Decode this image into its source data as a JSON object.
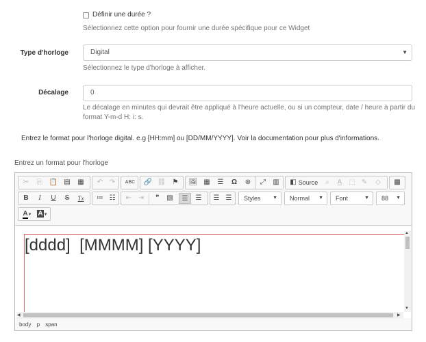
{
  "duration": {
    "checkbox_label": "Définir une durée ?",
    "help": "Sélectionnez cette option pour fournir une durée spécifique pour ce Widget",
    "checked": false
  },
  "clock_type": {
    "label": "Type d'horloge",
    "value": "Digital",
    "help": "Sélectionnez le type d'horloge à afficher."
  },
  "offset": {
    "label": "Décalage",
    "value": "0",
    "help_line1": "Le décalage en minutes qui devrait être appliqué à l'heure actuelle, ou si un compteur, date / heure à partir du",
    "help_line2": "format Y-m-d H: i: s."
  },
  "format_info": "Entrez le format pour l'horloge digital. e.g [HH:mm] ou [DD/MM/YYYY]. Voir la documentation pour plus d'informations.",
  "editor": {
    "label": "Entrez un format pour l'horloge",
    "source_label": "Source",
    "styles_label": "Styles",
    "format_label": "Normal",
    "font_label": "Font",
    "size_label": "88",
    "content": "[dddd]  [MMMM] [YYYY]",
    "path": [
      "body",
      "p",
      "span"
    ],
    "icons": {
      "cut": "✂",
      "copy": "⎘",
      "paste": "📋",
      "paste_text": "▤",
      "paste_word": "▦",
      "undo": "↶",
      "redo": "↷",
      "spellcheck": "ABC",
      "link": "🔗",
      "unlink": "⛓",
      "anchor": "⚑",
      "image": "🖼",
      "table": "▦",
      "hrule": "☰",
      "special_char": "Ω",
      "iframe": "⊛",
      "maximize": "⤢",
      "show_blocks": "▥",
      "source": "◧",
      "find": "⌕",
      "replace": "A̲",
      "select_all": "⬚",
      "remove_format_a": "✎",
      "templates": "◇",
      "qr": "▩",
      "bold": "B",
      "italic": "I",
      "underline": "U",
      "strike": "S",
      "clear": "Tx",
      "ol": "≔",
      "ul": "☷",
      "outdent": "⇤",
      "indent": "⇥",
      "quote": "❞",
      "div": "▧",
      "align_left": "☰",
      "align_center": "☰",
      "align_right": "☰",
      "justify": "☰",
      "text_color": "A",
      "bg_color": "A"
    }
  }
}
